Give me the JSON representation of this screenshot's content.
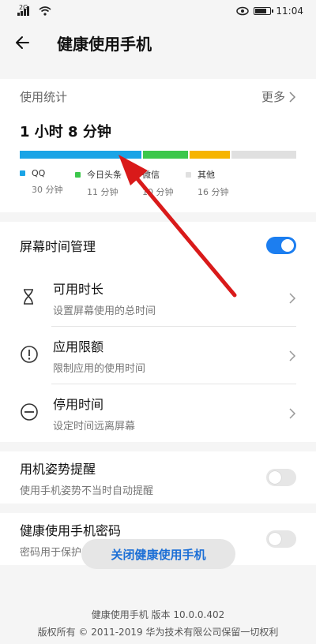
{
  "status_bar": {
    "network": "2G",
    "time": "11:04"
  },
  "header": {
    "title": "健康使用手机"
  },
  "usage": {
    "label": "使用统计",
    "more": "更多",
    "total": "1 小时 8 分钟",
    "apps": [
      {
        "name": "QQ",
        "time": "30 分钟",
        "color": "#1aa4e6",
        "minutes": 30
      },
      {
        "name": "今日头条",
        "time": "11 分钟",
        "color": "#3cc74b",
        "minutes": 11
      },
      {
        "name": "微信",
        "time": "10 分钟",
        "color": "#f6b400",
        "minutes": 10
      },
      {
        "name": "其他",
        "time": "16 分钟",
        "color": "#e0e0e0",
        "minutes": 16
      }
    ]
  },
  "screen_time": {
    "title": "屏幕时间管理",
    "enabled": true,
    "items": [
      {
        "title": "可用时长",
        "subtitle": "设置屏幕使用的总时间",
        "icon": "hourglass-icon"
      },
      {
        "title": "应用限额",
        "subtitle": "限制应用的使用时间",
        "icon": "exclamation-circle-icon"
      },
      {
        "title": "停用时间",
        "subtitle": "设定时间远离屏幕",
        "icon": "minus-circle-icon"
      }
    ]
  },
  "posture": {
    "title": "用机姿势提醒",
    "subtitle": "使用手机姿势不当时自动提醒",
    "enabled": false
  },
  "password": {
    "title": "健康使用手机密码",
    "subtitle": "密码用于保护“健康使用手机”的设置",
    "enabled": false
  },
  "close_button": "关闭健康使用手机",
  "footer": {
    "version": "健康使用手机 版本 10.0.0.402",
    "copyright": "版权所有 © 2011-2019 华为技术有限公司保留一切权利"
  },
  "annotation_color": "#d91a1a"
}
